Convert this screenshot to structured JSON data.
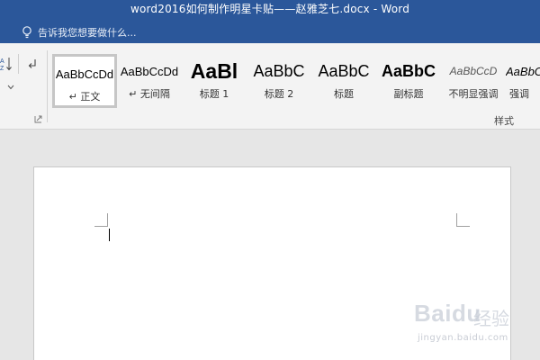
{
  "window": {
    "title": "word2016如何制作明星卡贴——赵雅芝七.docx - Word"
  },
  "tell_me": {
    "placeholder": "告诉我您想要做什么..."
  },
  "colors": {
    "titlebar": "#2b579a",
    "ribbon": "#f3f3f3",
    "canvas": "#e6e6e6"
  },
  "styles_gallery": {
    "group_label": "样式",
    "items": [
      {
        "preview": "AaBbCcDd",
        "name": "↵ 正文",
        "selected": true
      },
      {
        "preview": "AaBbCcDd",
        "name": "↵ 无间隔",
        "selected": false
      },
      {
        "preview": "AaBl",
        "name": "标题 1",
        "selected": false
      },
      {
        "preview": "AaBbC",
        "name": "标题 2",
        "selected": false
      },
      {
        "preview": "AaBbC",
        "name": "标题",
        "selected": false
      },
      {
        "preview": "AaBbC",
        "name": "副标题",
        "selected": false
      },
      {
        "preview": "AaBbCcD",
        "name": "不明显强调",
        "selected": false
      },
      {
        "preview": "AaBbC",
        "name": "强调",
        "selected": false
      }
    ]
  },
  "watermark": {
    "logo": "Baidu",
    "text": "经验",
    "url": "jingyan.baidu.com"
  }
}
